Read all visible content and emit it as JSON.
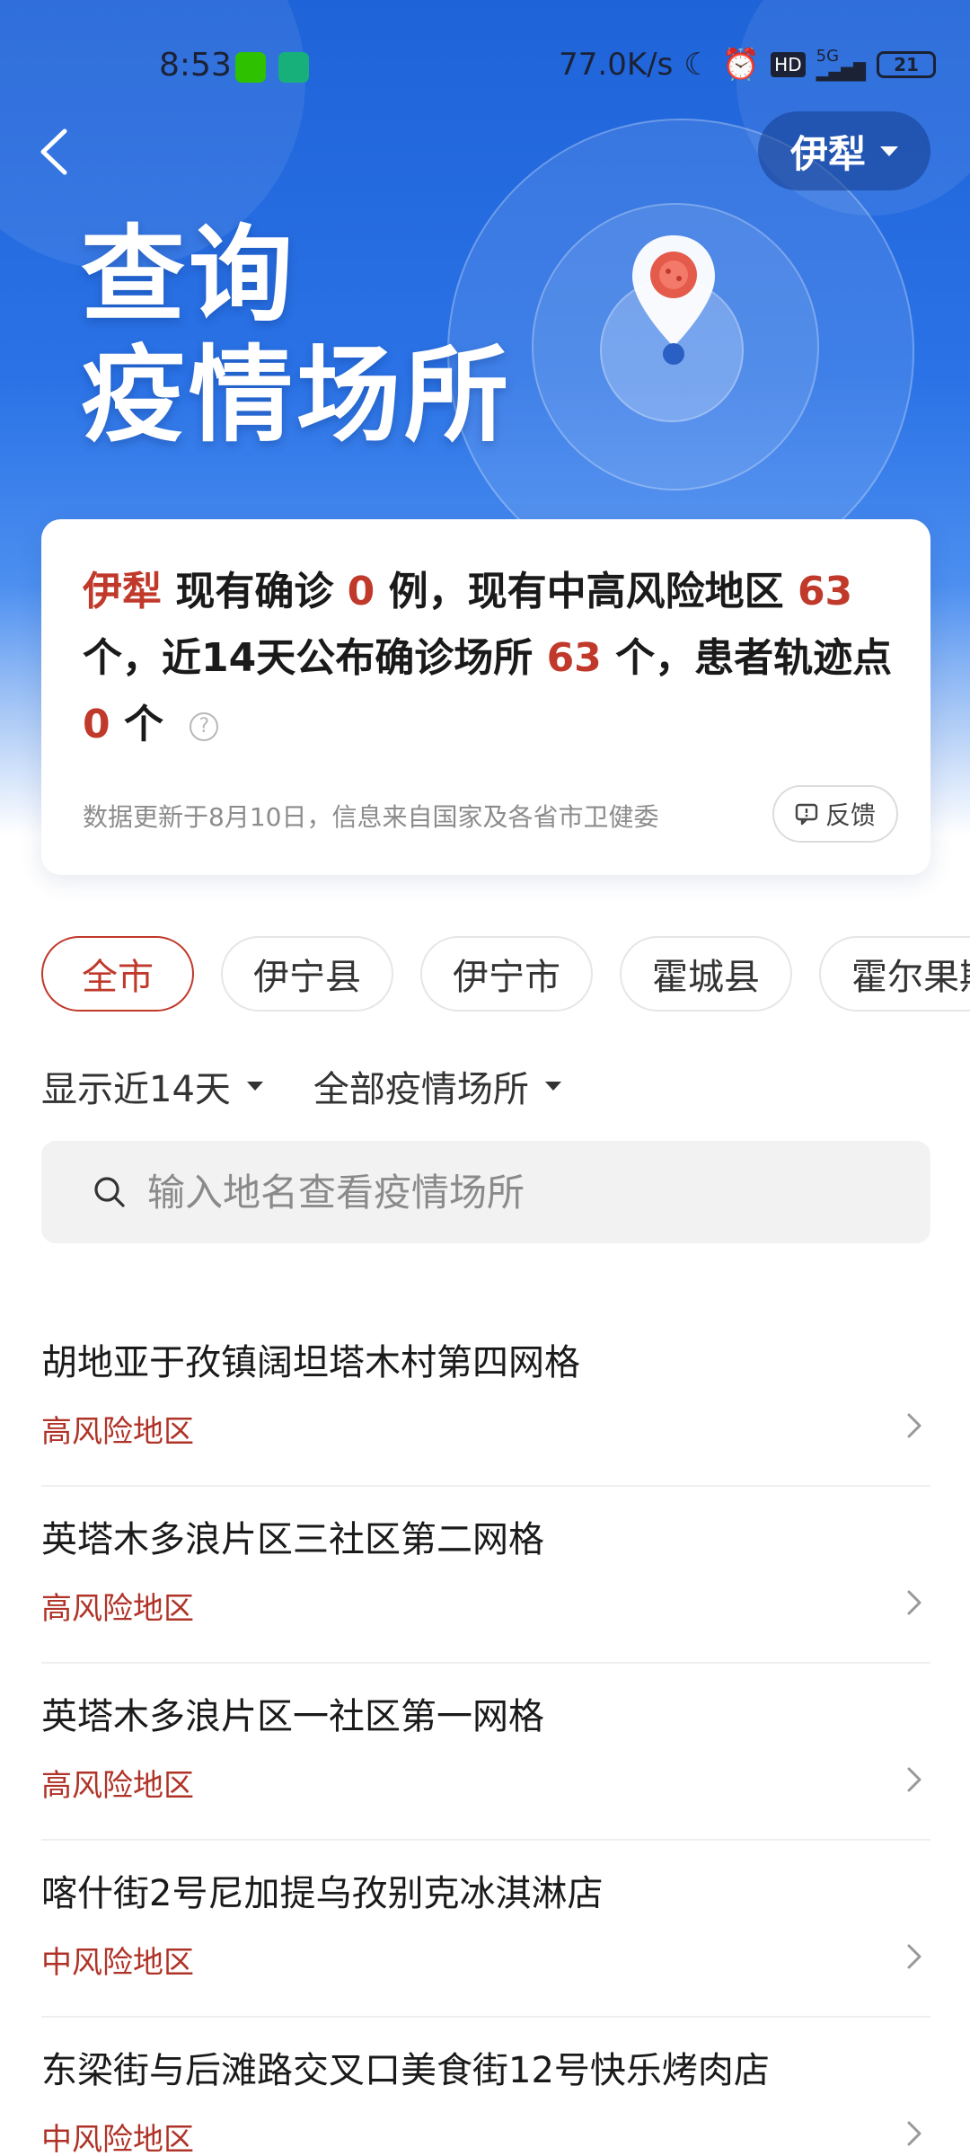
{
  "status_bar": {
    "time": "8:53",
    "net_speed": "77.0K/s",
    "signal": "5G",
    "battery": "21"
  },
  "header": {
    "city": "伊犁",
    "title_line1": "查询",
    "title_line2": "疫情场所"
  },
  "summary": {
    "city": "伊犁",
    "text_a": "现有确诊",
    "confirmed": "0",
    "text_b": "例，现有中高风险地区",
    "risk_areas": "63",
    "text_c": "个，近14天公布确诊场所",
    "places": "63",
    "text_d": "个，患者轨迹点",
    "track_points": "0",
    "text_e": "个",
    "update_note": "数据更新于8月10日，信息来自国家及各省市卫健委",
    "feedback_label": "反馈"
  },
  "districts": [
    "全市",
    "伊宁县",
    "伊宁市",
    "霍城县",
    "霍尔果斯"
  ],
  "filters": {
    "days": "显示近14天",
    "type": "全部疫情场所"
  },
  "search": {
    "placeholder": "输入地名查看疫情场所"
  },
  "places": [
    {
      "name": "胡地亚于孜镇阔坦塔木村第四网格",
      "level": "高风险地区"
    },
    {
      "name": "英塔木多浪片区三社区第二网格",
      "level": "高风险地区"
    },
    {
      "name": "英塔木多浪片区一社区第一网格",
      "level": "高风险地区"
    },
    {
      "name": "喀什街2号尼加提乌孜别克冰淇淋店",
      "level": "中风险地区"
    },
    {
      "name": "东梁街与后滩路交叉口美食街12号快乐烤肉店",
      "level": "中风险地区"
    }
  ],
  "colors": {
    "accent_red": "#c0392b",
    "hero_blue": "#2a72e6"
  }
}
